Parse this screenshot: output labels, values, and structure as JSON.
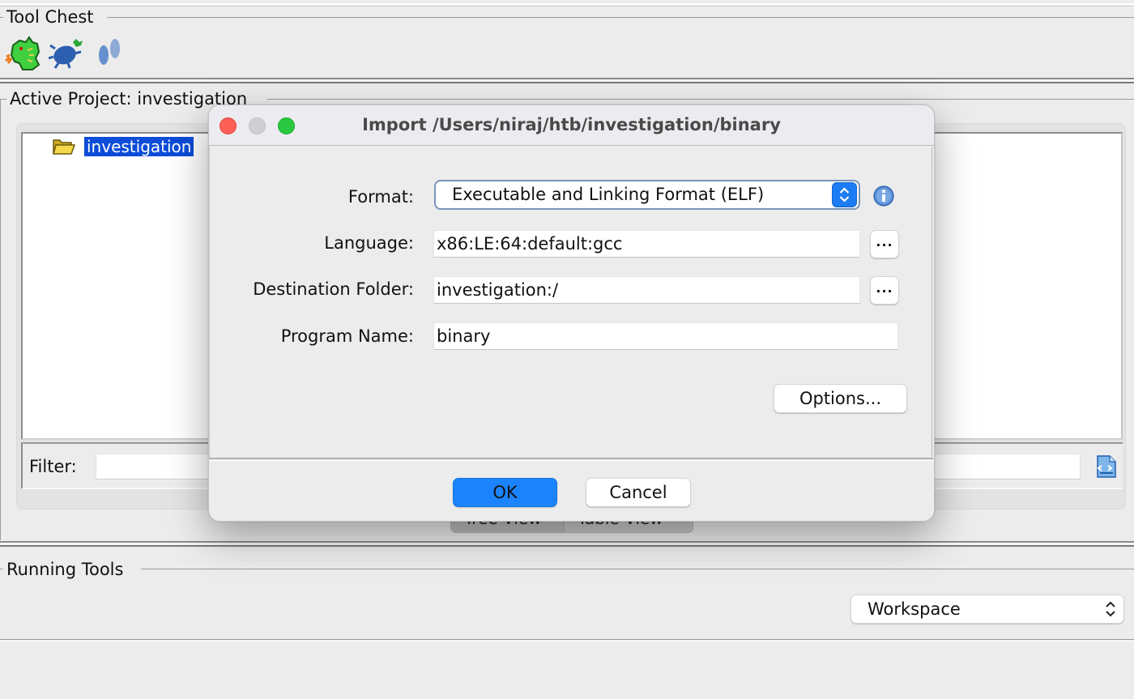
{
  "tool_chest": {
    "title": "Tool Chest",
    "tools": [
      {
        "name": "code-browser-dragon",
        "icon": "dragon-icon"
      },
      {
        "name": "debugger",
        "icon": "bug-icon"
      },
      {
        "name": "version-tracking",
        "icon": "footprints-icon"
      }
    ]
  },
  "active_project": {
    "title": "Active Project: investigation",
    "tree_root": {
      "label": "investigation",
      "icon": "folder-icon",
      "selected": true
    },
    "filter_label": "Filter:",
    "filter_value": "",
    "view_tabs": [
      {
        "label": "Tree View",
        "selected": true
      },
      {
        "label": "Table View",
        "selected": false
      }
    ]
  },
  "running_tools": {
    "title": "Running Tools",
    "workspace_select": "Workspace"
  },
  "dialog": {
    "title": "Import /Users/niraj/htb/investigation/binary",
    "fields": {
      "format_label": "Format:",
      "format_value": "Executable and Linking Format (ELF)",
      "language_label": "Language:",
      "language_value": "x86:LE:64:default:gcc",
      "destination_label": "Destination Folder:",
      "destination_value": "investigation:/",
      "program_name_label": "Program Name:",
      "program_name_value": "binary"
    },
    "browse_label": "...",
    "options_label": "Options...",
    "ok_label": "OK",
    "cancel_label": "Cancel",
    "accent_color": "#1b84fd"
  }
}
